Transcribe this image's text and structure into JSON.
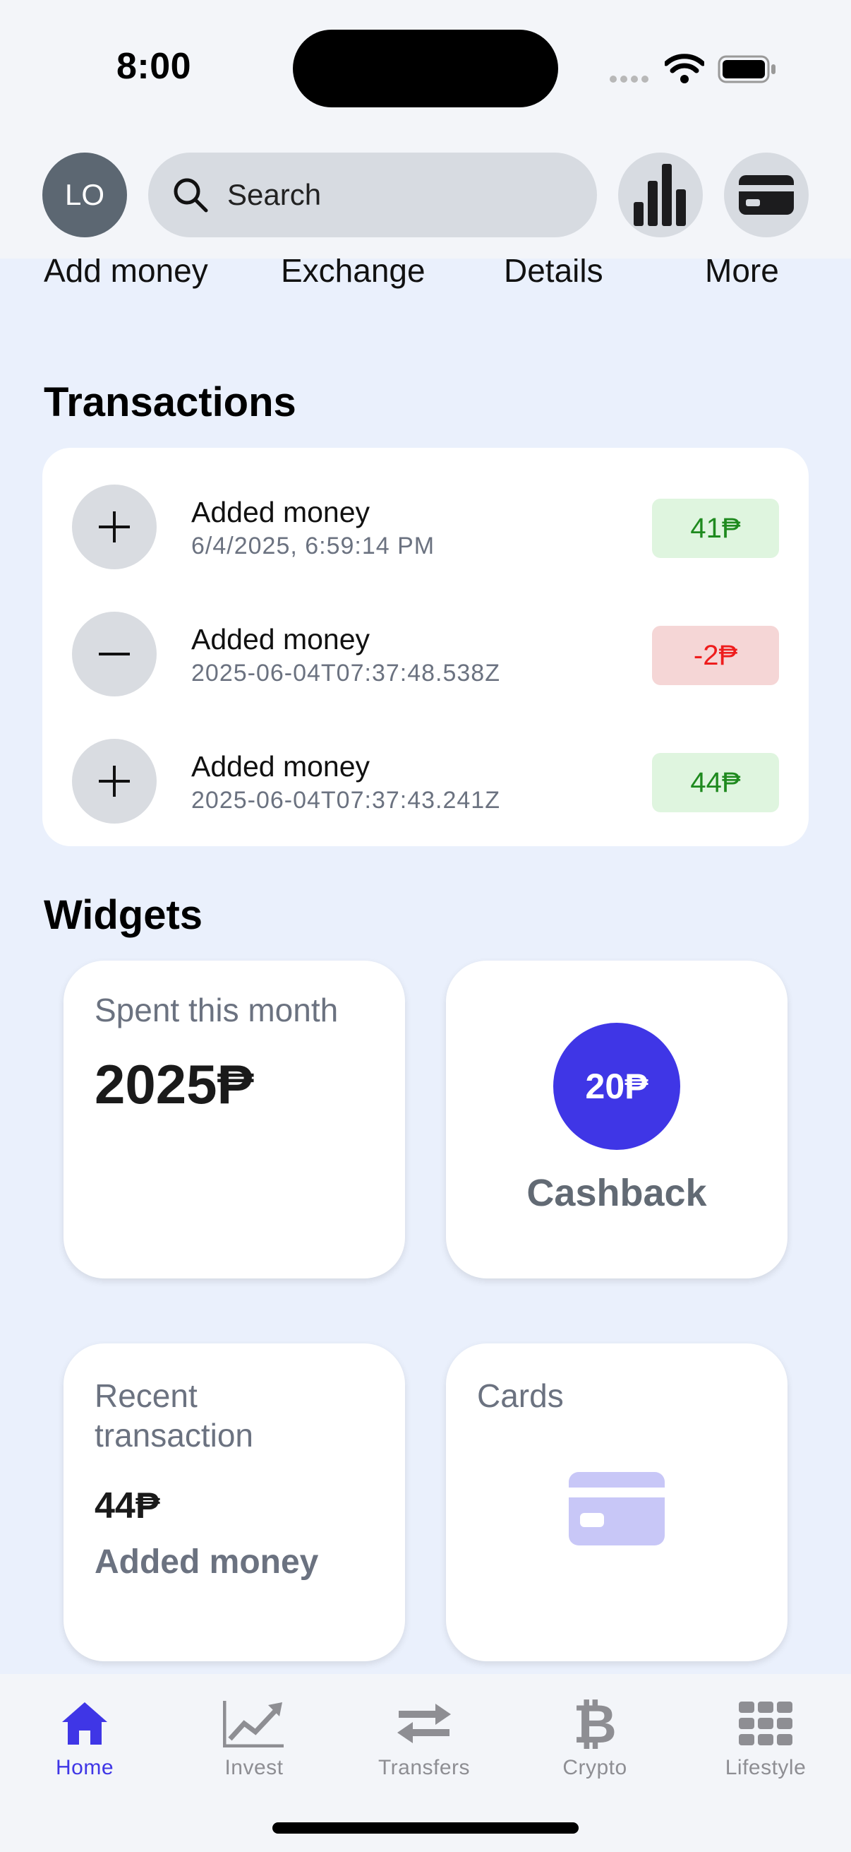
{
  "status_bar": {
    "time": "8:00"
  },
  "header": {
    "avatar_initials": "LO",
    "search_placeholder": "Search",
    "stats_icon": "bar-chart-icon",
    "cards_icon": "credit-card-icon"
  },
  "quick_actions": [
    "Add money",
    "Exchange",
    "Details",
    "More"
  ],
  "transactions": {
    "title": "Transactions",
    "items": [
      {
        "icon": "plus-icon",
        "title": "Added money",
        "date": "6/4/2025, 6:59:14 PM",
        "amount": "41₱",
        "kind": "positive"
      },
      {
        "icon": "minus-icon",
        "title": "Added money",
        "date": "2025-06-04T07:37:48.538Z",
        "amount": "-2₱",
        "kind": "negative"
      },
      {
        "icon": "plus-icon",
        "title": "Added money",
        "date": "2025-06-04T07:37:43.241Z",
        "amount": "44₱",
        "kind": "positive"
      }
    ]
  },
  "widgets": {
    "title": "Widgets",
    "spent": {
      "label": "Spent this month",
      "value": "2025₱"
    },
    "cashback": {
      "value": "20₱",
      "label": "Cashback"
    },
    "recent": {
      "label_line1": "Recent",
      "label_line2": "transaction",
      "amount": "44₱",
      "description": "Added money"
    },
    "cards": {
      "label": "Cards"
    }
  },
  "tabbar": {
    "items": [
      {
        "label": "Home",
        "icon": "home-icon",
        "active": true
      },
      {
        "label": "Invest",
        "icon": "chart-line-icon",
        "active": false
      },
      {
        "label": "Transfers",
        "icon": "transfer-arrows-icon",
        "active": false
      },
      {
        "label": "Crypto",
        "icon": "bitcoin-icon",
        "active": false
      },
      {
        "label": "Lifestyle",
        "icon": "grid-icon",
        "active": false
      }
    ]
  },
  "colors": {
    "accent": "#3f36e6",
    "positive_text": "#1f8a1f",
    "positive_bg": "#dff5df",
    "negative_text": "#ee1d1d",
    "negative_bg": "#f5d6d6",
    "background": "#eaf0fc"
  }
}
